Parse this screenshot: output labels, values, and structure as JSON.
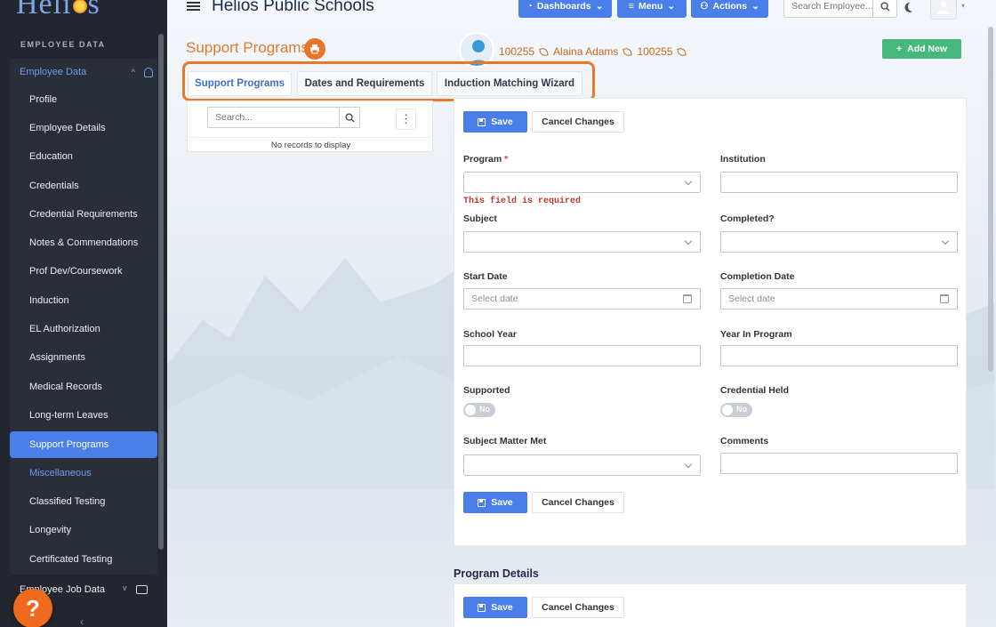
{
  "sidebar": {
    "section_label": "EMPLOYEE DATA",
    "group_label": "Employee Data",
    "items": [
      {
        "label": "Profile"
      },
      {
        "label": "Employee Details"
      },
      {
        "label": "Education"
      },
      {
        "label": "Credentials"
      },
      {
        "label": "Credential Requirements"
      },
      {
        "label": "Notes & Commendations"
      },
      {
        "label": "Prof Dev/Coursework"
      },
      {
        "label": "Induction"
      },
      {
        "label": "EL Authorization"
      },
      {
        "label": "Assignments"
      },
      {
        "label": "Medical Records"
      },
      {
        "label": "Long-term Leaves"
      },
      {
        "label": "Support Programs"
      },
      {
        "label": "Miscellaneous"
      },
      {
        "label": "Classified Testing"
      },
      {
        "label": "Longevity"
      },
      {
        "label": "Certificated Testing"
      }
    ],
    "job_group_label": "Employee Job Data",
    "help_label": "?",
    "collapse_label": "‹"
  },
  "topbar": {
    "brand": "Helios Public Schools",
    "logo_text_a": "Heli",
    "logo_text_b": "s",
    "dashboards": "Dashboards",
    "menu": "Menu",
    "actions": "Actions",
    "search_placeholder": "Search Employee..."
  },
  "page": {
    "title": "Support Programs",
    "employee_id": "100255",
    "employee_name": "Alaina Adams",
    "employee_id2": "100255",
    "add_new": "Add New"
  },
  "tabs": [
    {
      "label": "Support Programs",
      "active": true
    },
    {
      "label": "Dates and Requirements",
      "active": false
    },
    {
      "label": "Induction Matching Wizard",
      "active": false
    }
  ],
  "list": {
    "search_placeholder": "Search...",
    "empty_text": "No records to display"
  },
  "form": {
    "save": "Save",
    "cancel": "Cancel Changes",
    "program_label": "Program",
    "required_mark": "*",
    "program_error": "This field is required",
    "institution_label": "Institution",
    "subject_label": "Subject",
    "completed_label": "Completed?",
    "start_date_label": "Start Date",
    "start_date_placeholder": "Select date",
    "completion_date_label": "Completion Date",
    "completion_date_placeholder": "Select date",
    "school_year_label": "School Year",
    "year_in_program_label": "Year In Program",
    "supported_label": "Supported",
    "supported_value": "No",
    "credential_held_label": "Credential Held",
    "credential_held_value": "No",
    "subject_matter_label": "Subject Matter Met",
    "comments_label": "Comments"
  },
  "program_details": {
    "title": "Program Details",
    "save": "Save",
    "cancel": "Cancel Changes"
  },
  "colors": {
    "accent_blue": "#4a7ee8",
    "brand_orange": "#e8742a",
    "add_green": "#46b87b",
    "sidebar_bg": "#23262f"
  }
}
